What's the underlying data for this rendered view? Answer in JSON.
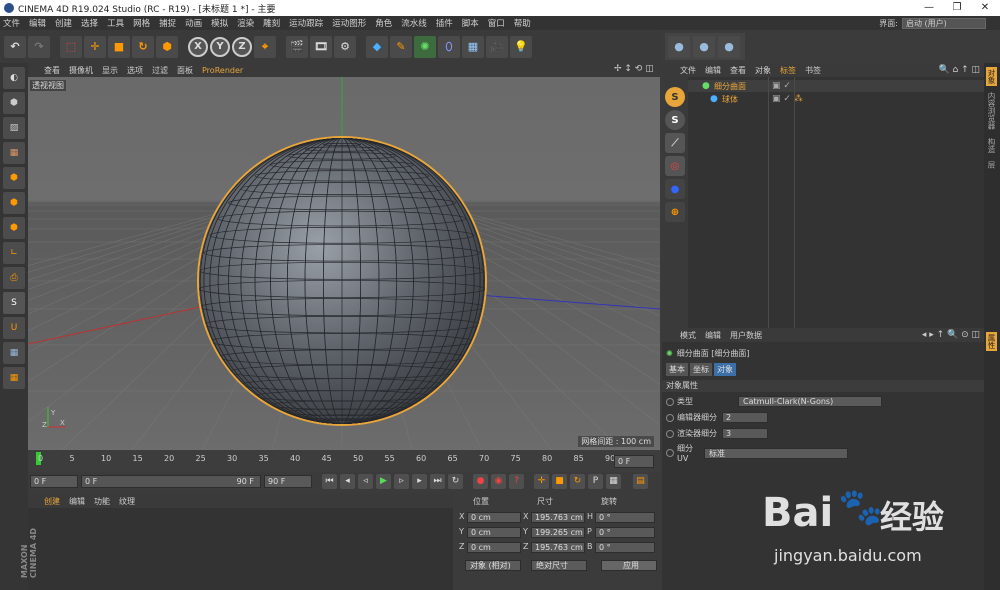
{
  "window": {
    "title": "CINEMA 4D R19.024 Studio (RC - R19) - [未标题 1 *] - 主要"
  },
  "menubar": [
    "文件",
    "编辑",
    "创建",
    "选择",
    "工具",
    "网格",
    "捕捉",
    "动画",
    "模拟",
    "渲染",
    "雕刻",
    "运动跟踪",
    "运动图形",
    "角色",
    "流水线",
    "插件",
    "脚本",
    "窗口",
    "帮助"
  ],
  "layout": {
    "label": "界面:",
    "value": "启动 (用户)"
  },
  "viewport": {
    "menu": [
      "查看",
      "摄像机",
      "显示",
      "选项",
      "过滤",
      "面板",
      "ProRender"
    ],
    "label": "透视视图",
    "grid_info": "网格间距 : 100 cm"
  },
  "timeline": {
    "ticks": [
      "0",
      "5",
      "10",
      "15",
      "20",
      "25",
      "30",
      "35",
      "40",
      "45",
      "50",
      "55",
      "60",
      "65",
      "70",
      "75",
      "80",
      "85",
      "90"
    ],
    "frame_end_field": "0 F"
  },
  "transport": {
    "start": "0 F",
    "slider_left": "0 F",
    "slider_right": "90 F",
    "end": "90 F"
  },
  "material": {
    "tabs": [
      "创建",
      "编辑",
      "功能",
      "纹理"
    ]
  },
  "coords": {
    "headers": [
      "位置",
      "尺寸",
      "旋转"
    ],
    "rows": [
      {
        "a": "X",
        "pos": "0 cm",
        "b": "X",
        "size": "195.763 cm",
        "c": "H",
        "rot": "0 °"
      },
      {
        "a": "Y",
        "pos": "0 cm",
        "b": "Y",
        "size": "199.265 cm",
        "c": "P",
        "rot": "0 °"
      },
      {
        "a": "Z",
        "pos": "0 cm",
        "b": "Z",
        "size": "195.763 cm",
        "c": "B",
        "rot": "0 °"
      }
    ],
    "mode": "对象 (相对)",
    "size_mode": "绝对尺寸",
    "apply": "应用"
  },
  "objects": {
    "menu": [
      "文件",
      "编辑",
      "查看",
      "对象",
      "标签",
      "书签"
    ],
    "items": [
      {
        "name": "细分曲面"
      },
      {
        "name": "球体"
      }
    ]
  },
  "attributes": {
    "menu": [
      "模式",
      "编辑",
      "用户数据"
    ],
    "title": "细分曲面 [细分曲面]",
    "tabs": [
      "基本",
      "坐标",
      "对象"
    ],
    "section": "对象属性",
    "type_label": "类型",
    "type_value": "Catmull-Clark(N-Gons)",
    "editor_label": "编辑器细分",
    "editor_value": "2",
    "render_label": "渲染器细分",
    "render_value": "3",
    "uv_label": "细分 UV",
    "uv_value": "标准"
  },
  "right_tabs": [
    "对象",
    "内容浏览器",
    "构造",
    "层"
  ],
  "right_tabs_lower": [
    "属性"
  ],
  "watermark": {
    "brand": "Bai",
    "brand2": "经验",
    "url": "jingyan.baidu.com"
  },
  "colors": {
    "accent_orange": "#e8a53a",
    "selection": "#ff8c00"
  }
}
